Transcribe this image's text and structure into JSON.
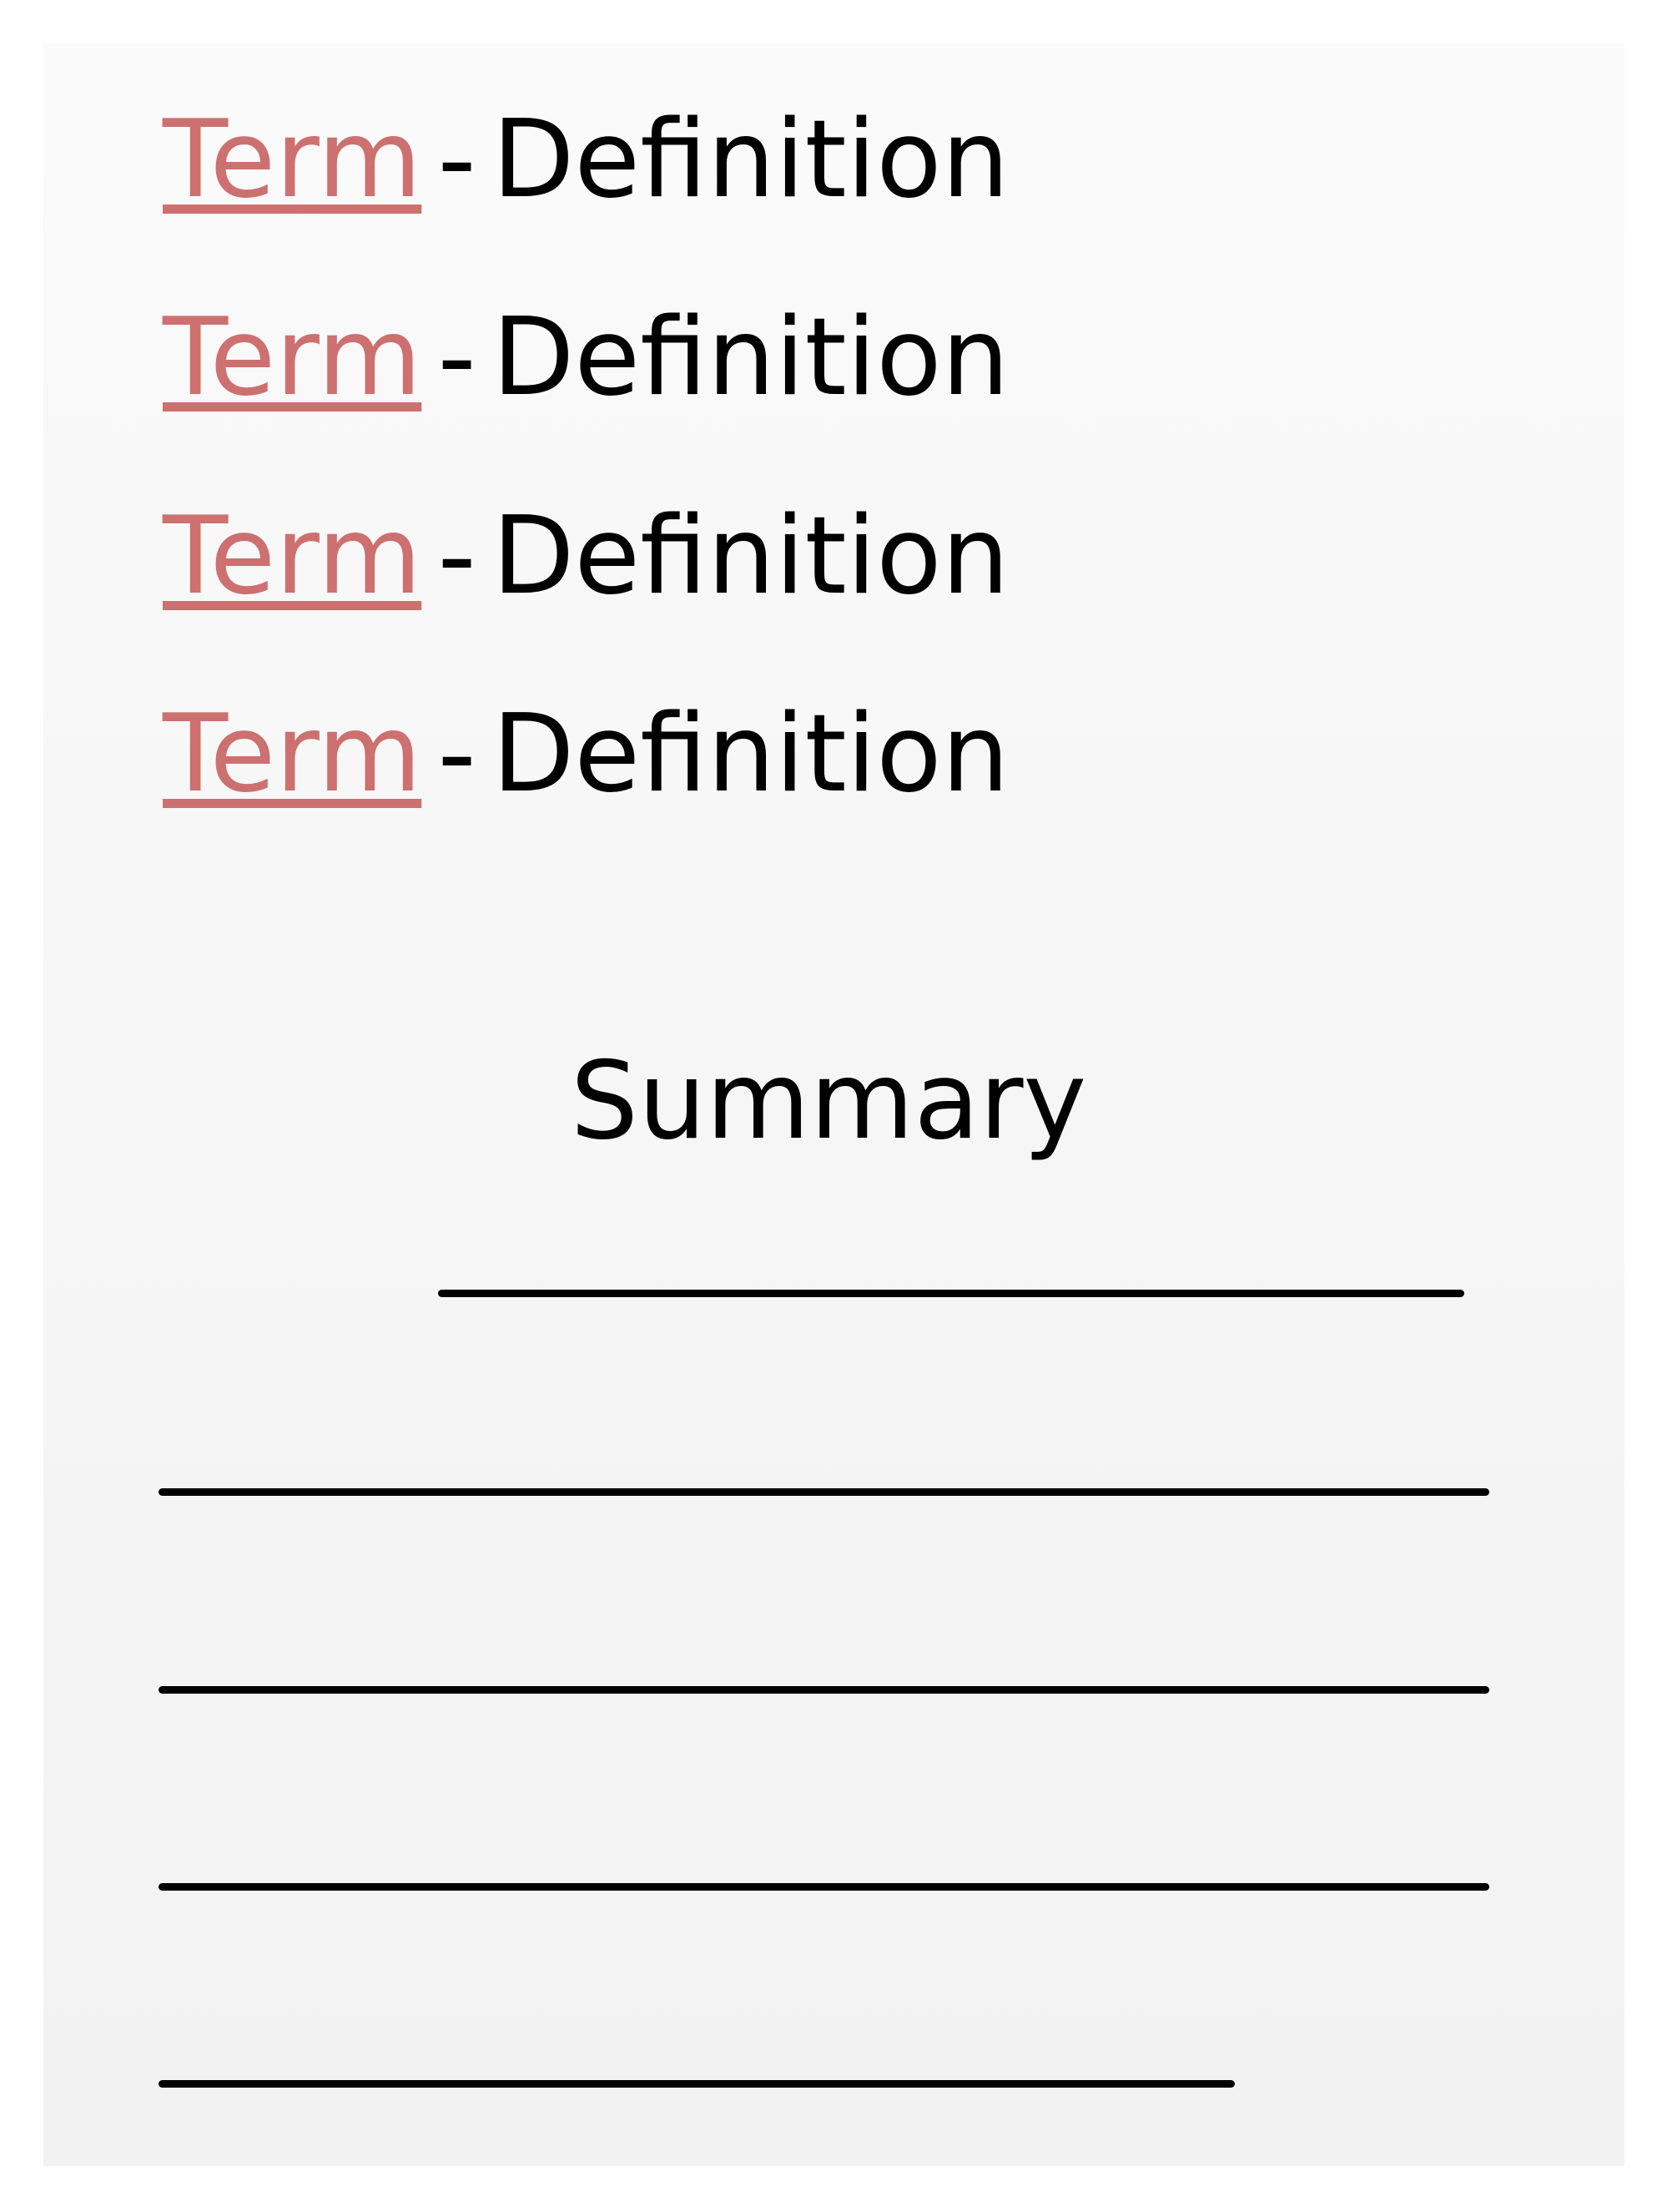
{
  "colors": {
    "term": "#cd7070",
    "text": "#000000",
    "lines": "#000000"
  },
  "entries": [
    {
      "term": "Term",
      "separator": "-",
      "definition": "Definition"
    },
    {
      "term": "Term",
      "separator": "-",
      "definition": "Definition"
    },
    {
      "term": "Term",
      "separator": "-",
      "definition": "Definition"
    },
    {
      "term": "Term",
      "separator": "-",
      "definition": "Definition"
    }
  ],
  "summary": {
    "heading": "Summary",
    "blank_line_count": 5
  }
}
